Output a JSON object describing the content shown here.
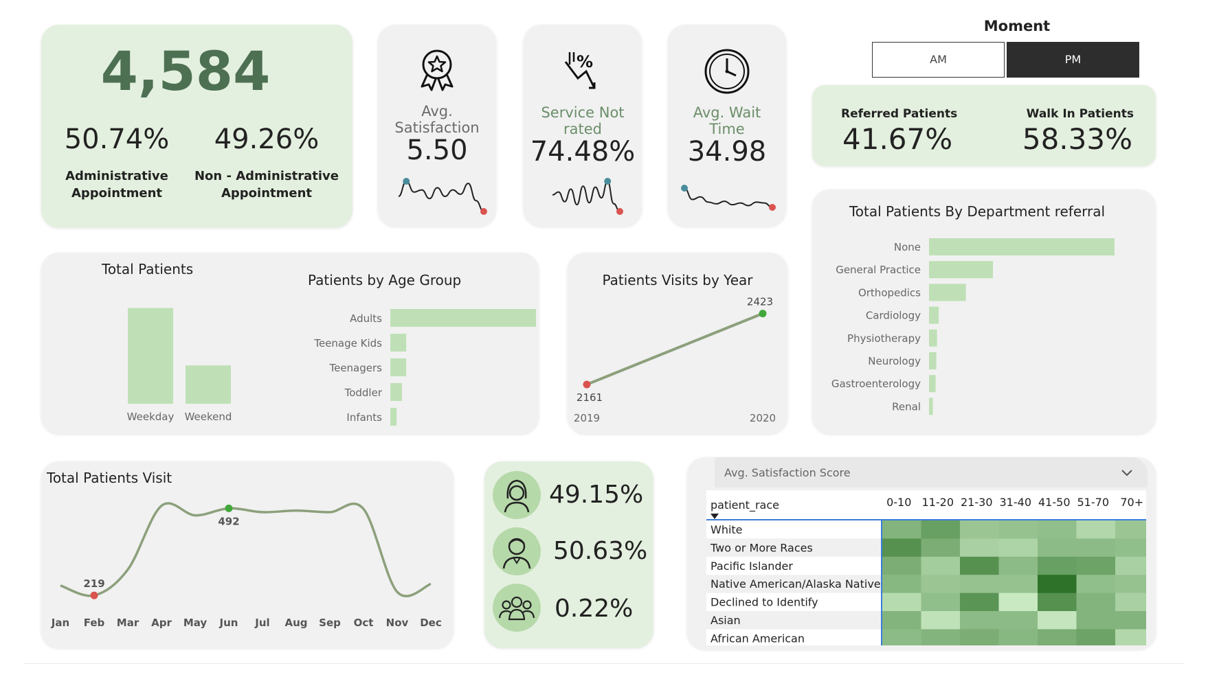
{
  "kpi_main": {
    "total": "4,584",
    "admin_pct": "50.74%",
    "admin_label_1": "Administrative",
    "admin_label_2": "Appointment",
    "nonadmin_pct": "49.26%",
    "nonadmin_label_1": "Non - Administrative",
    "nonadmin_label_2": "Appointment"
  },
  "kpi_cards": [
    {
      "label_1": "Avg.",
      "label_2": "Satisfaction",
      "value": "5.50",
      "icon": "award-ribbon-icon"
    },
    {
      "label_1": "Service Not",
      "label_2": "rated",
      "value": "74.48%",
      "icon": "percent-arrow-down-icon"
    },
    {
      "label_1": "Avg. Wait",
      "label_2": "Time",
      "value": "34.98",
      "icon": "clock-icon"
    }
  ],
  "sparkline_values": [
    [
      4.9,
      5.6,
      5.1,
      5.2,
      4.8,
      5.3,
      4.9,
      5.2,
      5.0,
      5.5,
      4.7,
      4.2
    ],
    [
      4.9,
      5.2,
      4.2,
      5.5,
      3.9,
      5.8,
      4.1,
      5.7,
      4.6,
      6.3,
      4.0,
      3.2
    ],
    [
      6.3,
      5.0,
      5.3,
      4.7,
      4.5,
      4.8,
      4.4,
      4.6,
      4.3,
      4.7,
      4.6,
      4.1
    ]
  ],
  "moment": {
    "title": "Moment",
    "options": [
      "AM",
      "PM"
    ],
    "selected": "PM"
  },
  "referral": {
    "referred_label": "Referred Patients",
    "referred_value": "41.67%",
    "walkin_label": "Walk In Patients",
    "walkin_value": "58.33%"
  },
  "colors": {
    "bar_green": "#bfe0b6",
    "line_green": "#8ca07c",
    "accent_green": "#41a73a",
    "marker_red": "#d9534f",
    "marker_teal": "#4a8d9c",
    "dark_green_text": "#4e7052",
    "selected_dark": "#2d2d2d"
  },
  "total_patients": {
    "title": "Total Patients",
    "chart_data": {
      "type": "bar",
      "categories": [
        "Weekday",
        "Weekend"
      ],
      "values": [
        3250,
        1300
      ]
    }
  },
  "age_group": {
    "title": "Patients by Age Group",
    "chart_data": {
      "type": "bar",
      "orientation": "horizontal",
      "categories": [
        "Adults",
        "Teenage Kids",
        "Teenagers",
        "Toddler",
        "Infants"
      ],
      "values": [
        3400,
        300,
        300,
        220,
        120
      ]
    }
  },
  "visits_by_year": {
    "title": "Patients Visits by Year",
    "chart_data": {
      "type": "line",
      "x": [
        "2019",
        "2020"
      ],
      "values": [
        2161,
        2423
      ],
      "labels": [
        "2161",
        "2423"
      ]
    }
  },
  "department": {
    "title": "Total Patients By Department referral",
    "chart_data": {
      "type": "bar",
      "orientation": "horizontal",
      "categories": [
        "None",
        "General Practice",
        "Orthopedics",
        "Cardiology",
        "Physiotherapy",
        "Neurology",
        "Gastroenterology",
        "Renal"
      ],
      "values": [
        2670,
        920,
        530,
        140,
        115,
        105,
        95,
        55
      ]
    }
  },
  "monthly_visits": {
    "title": "Total Patients Visit",
    "chart_data": {
      "type": "line",
      "x": [
        "Jan",
        "Feb",
        "Mar",
        "Apr",
        "May",
        "Jun",
        "Jul",
        "Aug",
        "Sep",
        "Oct",
        "Nov",
        "Dec"
      ],
      "values": [
        250,
        219,
        300,
        500,
        470,
        492,
        480,
        485,
        480,
        490,
        230,
        255
      ],
      "min_label": "219",
      "max_label": "492",
      "min_month": "Feb",
      "max_month": "Jun"
    }
  },
  "gender": {
    "items": [
      {
        "value": "49.15%",
        "icon": "female-avatar-icon"
      },
      {
        "value": "50.63%",
        "icon": "male-avatar-icon"
      },
      {
        "value": "0.22%",
        "icon": "group-icon"
      }
    ]
  },
  "matrix": {
    "title": "Avg. Satisfaction Score",
    "row_header": "patient_race",
    "chart_data": {
      "type": "heatmap",
      "columns": [
        "0-10",
        "11-20",
        "21-30",
        "31-40",
        "41-50",
        "51-70",
        "70+"
      ],
      "rows": [
        "White",
        "Two or More Races",
        "Pacific Islander",
        "Native American/Alaska Native",
        "Declined to Identify",
        "Asian",
        "African American"
      ],
      "values": [
        [
          5.4,
          6.0,
          4.9,
          5.0,
          5.1,
          4.4,
          4.9
        ],
        [
          6.4,
          5.6,
          4.6,
          4.5,
          5.2,
          5.2,
          5.1
        ],
        [
          5.6,
          4.7,
          6.4,
          5.2,
          6.0,
          5.9,
          4.6
        ],
        [
          5.3,
          4.9,
          5.0,
          5.0,
          7.3,
          5.1,
          5.0
        ],
        [
          4.3,
          5.1,
          6.3,
          3.9,
          6.4,
          5.4,
          4.6
        ],
        [
          5.4,
          4.1,
          5.2,
          5.2,
          4.0,
          5.4,
          5.4
        ],
        [
          5.2,
          5.4,
          5.6,
          5.3,
          5.6,
          5.9,
          4.4
        ]
      ]
    }
  }
}
